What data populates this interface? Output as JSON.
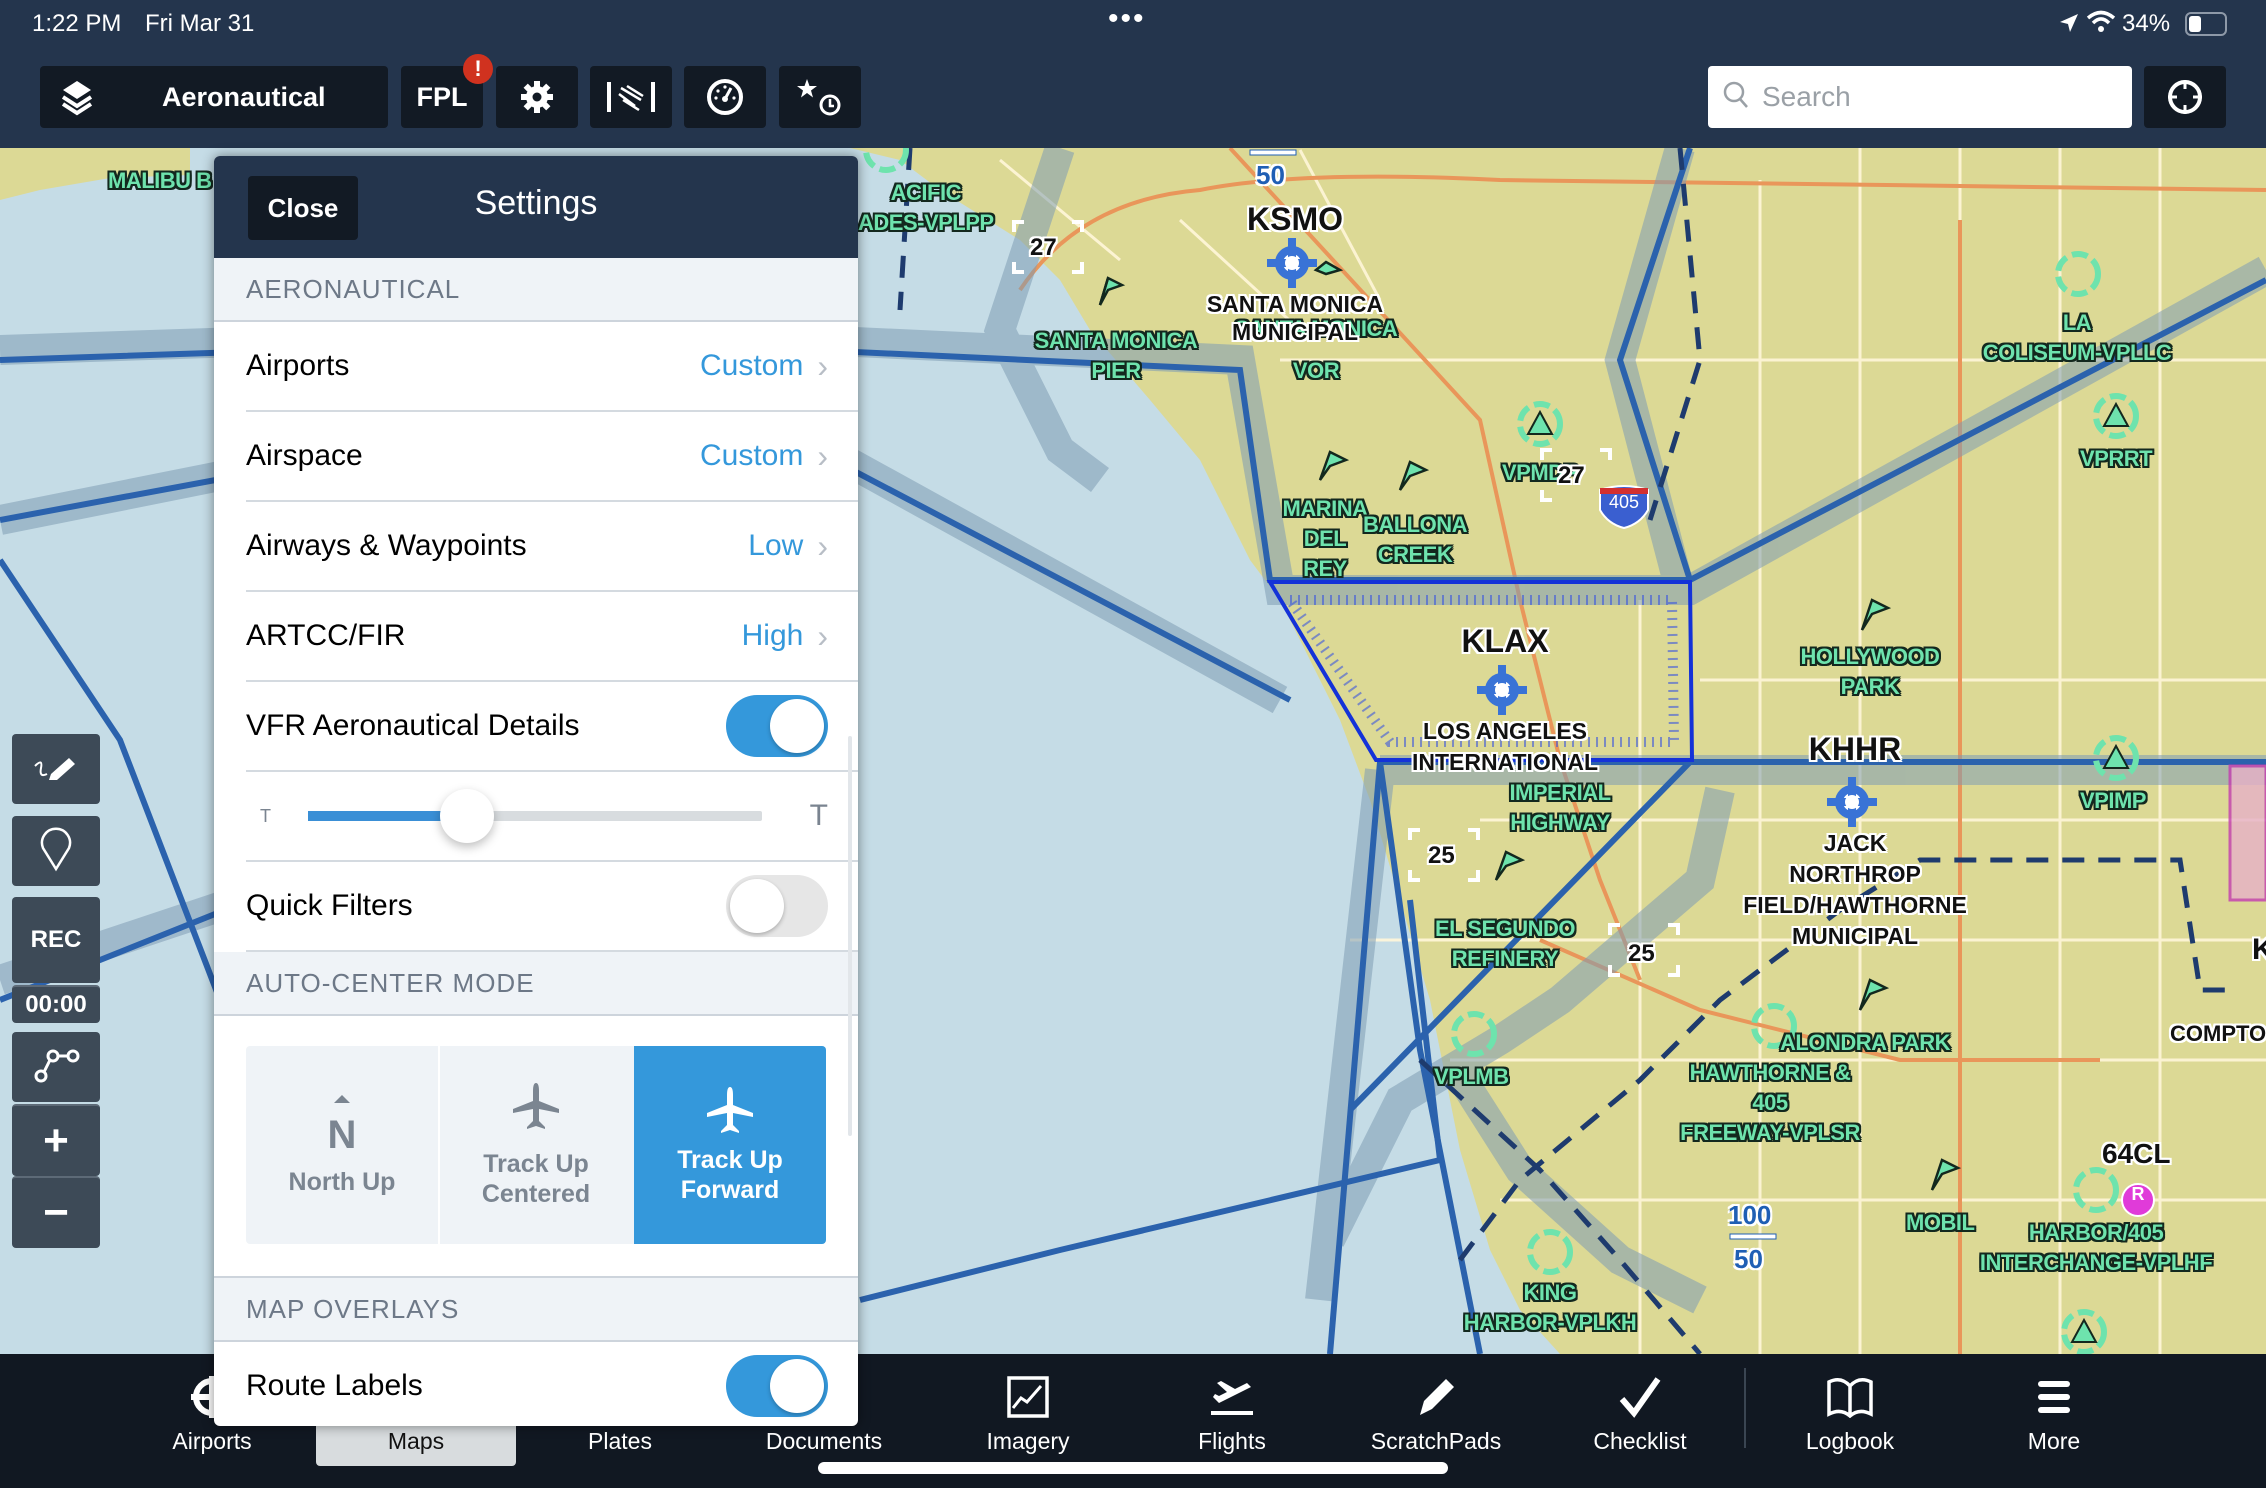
{
  "status_bar": {
    "time": "1:22 PM",
    "date": "Fri Mar 31",
    "dots": "•••",
    "battery": "34%",
    "battery_level": 0.34
  },
  "toolbar": {
    "layer_label": "Aeronautical",
    "fpl_label": "FPL",
    "fpl_badge": "!",
    "search_placeholder": "Search",
    "search_value": ""
  },
  "settings": {
    "close_label": "Close",
    "title": "Settings",
    "sections": {
      "aeronautical": "AERONAUTICAL",
      "auto_center": "AUTO-CENTER MODE",
      "map_overlays": "MAP OVERLAYS"
    },
    "rows": [
      {
        "label": "Airports",
        "value": "Custom"
      },
      {
        "label": "Airspace",
        "value": "Custom"
      },
      {
        "label": "Airways & Waypoints",
        "value": "Low"
      },
      {
        "label": "ARTCC/FIR",
        "value": "High"
      }
    ],
    "vfr_details": {
      "label": "VFR Aeronautical Details",
      "on": true
    },
    "text_size": {
      "small_label": "T",
      "large_label": "T",
      "value": 0.35
    },
    "quick_filters": {
      "label": "Quick Filters",
      "on": false
    },
    "auto_center_modes": [
      {
        "label_line1": "North Up",
        "label_line2": "",
        "icon_text": "N",
        "selected": false
      },
      {
        "label_line1": "Track Up",
        "label_line2": "Centered",
        "selected": false
      },
      {
        "label_line1": "Track Up",
        "label_line2": "Forward",
        "selected": true
      }
    ],
    "route_labels": {
      "label": "Route Labels",
      "on": true
    },
    "accent_color": "#3498db"
  },
  "left_tools": {
    "rec_label": "REC",
    "rec_time": "00:00",
    "zoom_in": "+",
    "zoom_out": "−"
  },
  "map": {
    "airports": [
      {
        "ident": "KSMO",
        "name_lines": [
          "SANTA MONICA",
          "MUNICIPAL"
        ]
      },
      {
        "ident": "KLAX",
        "name_lines": [
          "LOS ANGELES",
          "INTERNATIONAL"
        ]
      },
      {
        "ident": "KHHR",
        "name_lines": [
          "JACK",
          "NORTHROP",
          "FIELD/HAWTHORNE",
          "MUNICIPAL"
        ]
      },
      {
        "ident": "64CL",
        "name_lines": []
      }
    ],
    "places": {
      "malibu": "MALIBU B",
      "pacific1": "ACIFIC",
      "pacific2": "ADES-VPLPP",
      "sm_pier1": "SANTA MONICA",
      "sm_pier2": "PIER",
      "sm_vor1": "SANTA MONICA",
      "sm_vor2": "VOR",
      "marina1": "MARINA DEL",
      "marina2": "REY",
      "ballona1": "BALLONA",
      "ballona2": "CREEK",
      "vpm": "VPMDP",
      "la_col1": "LA",
      "la_col2": "COLISEUM-VPLLC",
      "vprrt": "VPRRT",
      "hollywood1": "HOLLYWOOD",
      "hollywood2": "PARK",
      "imperial1": "IMPERIAL",
      "imperial2": "HIGHWAY",
      "elseg1": "EL SEGUNDO",
      "elseg2": "REFINERY",
      "vpimp": "VPIMP",
      "vplmb": "VPLMB",
      "alondra": "ALONDRA PARK",
      "hawthorne1": "HAWTHORNE &",
      "hawthorne2": "405",
      "hawthorne3": "FREEWAY-VPLSR",
      "mobil": "MOBIL",
      "harbor1": "HARBOR/405",
      "harbor2": "INTERCHANGE-VPLHF",
      "king1": "KING",
      "king2": "HARBOR-VPLKH",
      "compton": "COMPTO",
      "k_partial": "K"
    },
    "altitudes": {
      "top_50": "50",
      "alt_100": "100",
      "alt_50": "50"
    },
    "runway_numbers": [
      "27",
      "27",
      "25",
      "25"
    ],
    "interstate": "405",
    "restricted_badge": "R"
  },
  "tabs": [
    {
      "label": "Airports",
      "active": false
    },
    {
      "label": "Maps",
      "active": true
    },
    {
      "label": "Plates",
      "active": false
    },
    {
      "label": "Documents",
      "active": false
    },
    {
      "label": "Imagery",
      "active": false
    },
    {
      "label": "Flights",
      "active": false
    },
    {
      "label": "ScratchPads",
      "active": false
    },
    {
      "label": "Checklist",
      "active": false
    },
    {
      "label": "Logbook",
      "active": false
    },
    {
      "label": "More",
      "active": false
    }
  ]
}
